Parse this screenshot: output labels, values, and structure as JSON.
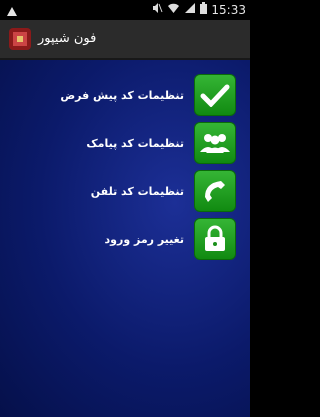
{
  "statusbar": {
    "time": "15:33"
  },
  "app": {
    "title": "فون شیپور"
  },
  "menu": [
    {
      "label": "تنظیمات کد پیش فرض",
      "icon": "checkmark-icon"
    },
    {
      "label": "تنظیمات کد پیامک",
      "icon": "people-icon"
    },
    {
      "label": "تنظیمات کد تلفن",
      "icon": "phone-icon"
    },
    {
      "label": "تغییر رمز ورود",
      "icon": "lock-icon"
    }
  ],
  "colors": {
    "accent": "#22a022",
    "background": "#0b1a6a",
    "actionbar": "#2b2b2b"
  }
}
